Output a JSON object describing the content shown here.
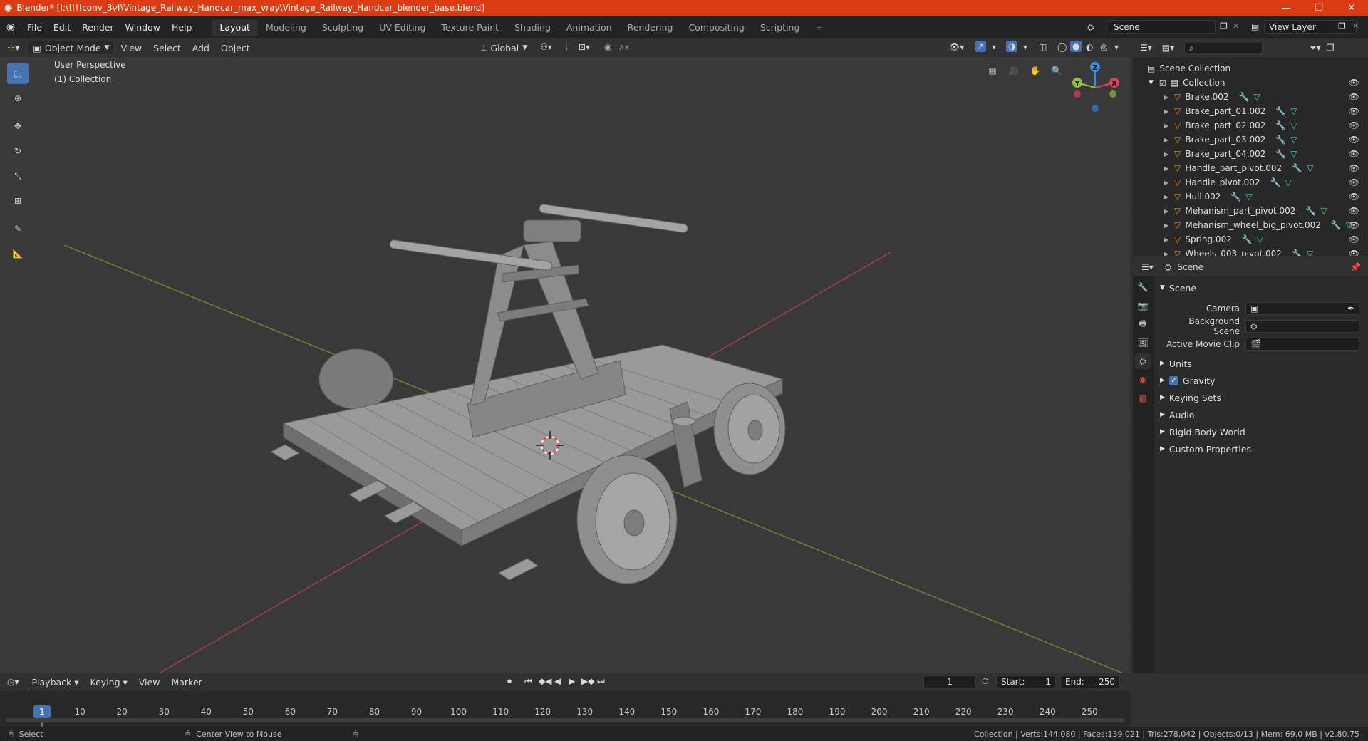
{
  "title": "Blender* [I:\\!!!!conv_3\\4\\Vintage_Railway_Handcar_max_vray\\Vintage_Railway_Handcar_blender_base.blend]",
  "menu": [
    "File",
    "Edit",
    "Render",
    "Window",
    "Help"
  ],
  "workspaces": [
    "Layout",
    "Modeling",
    "Sculpting",
    "UV Editing",
    "Texture Paint",
    "Shading",
    "Animation",
    "Rendering",
    "Compositing",
    "Scripting"
  ],
  "active_workspace": "Layout",
  "scene_field": "Scene",
  "view_layer_field": "View Layer",
  "viewport_header": {
    "mode": "Object Mode",
    "view": "View",
    "select": "Select",
    "add": "Add",
    "object": "Object",
    "transform_orientation": "Global"
  },
  "viewport": {
    "perspective_label": "User Perspective",
    "collection_label": "(1) Collection",
    "axes": {
      "x": "X",
      "y": "Y",
      "z": "Z"
    }
  },
  "outliner": {
    "root": "Scene Collection",
    "collection": "Collection",
    "items": [
      "Brake.002",
      "Brake_part_01.002",
      "Brake_part_02.002",
      "Brake_part_03.002",
      "Brake_part_04.002",
      "Handle_part_pivot.002",
      "Handle_pivot.002",
      "Hull.002",
      "Mehanism_part_pivot.002",
      "Mehanism_wheel_big_pivot.002",
      "Spring.002",
      "Wheels_003_pivot.002"
    ]
  },
  "properties": {
    "header": "Scene",
    "panel": "Scene",
    "fields": [
      {
        "label": "Camera"
      },
      {
        "label": "Background Scene"
      },
      {
        "label": "Active Movie Clip"
      }
    ],
    "sections": [
      "Units",
      "Gravity",
      "Keying Sets",
      "Audio",
      "Rigid Body World",
      "Custom Properties"
    ]
  },
  "timeline": {
    "menus": [
      "Playback",
      "Keying",
      "View",
      "Marker"
    ],
    "current_frame": "1",
    "start_label": "Start:",
    "start": "1",
    "end_label": "End:",
    "end": "250",
    "ticks": [
      "1",
      "10",
      "20",
      "30",
      "40",
      "50",
      "60",
      "70",
      "80",
      "90",
      "100",
      "110",
      "120",
      "130",
      "140",
      "150",
      "160",
      "170",
      "180",
      "190",
      "200",
      "210",
      "220",
      "230",
      "240",
      "250"
    ]
  },
  "statusbar": {
    "left1": "Select",
    "left2": "Center View to Mouse",
    "right": "Collection | Verts:144,080 | Faces:139,021 | Tris:278,042 | Objects:0/13 | Mem: 69.0 MB | v2.80.75"
  },
  "colors": {
    "titlebar": "#db3b12",
    "accent": "#4772b3",
    "x_axis": "#e0405a",
    "y_axis": "#8cc43f",
    "z_axis": "#3d8de3"
  }
}
